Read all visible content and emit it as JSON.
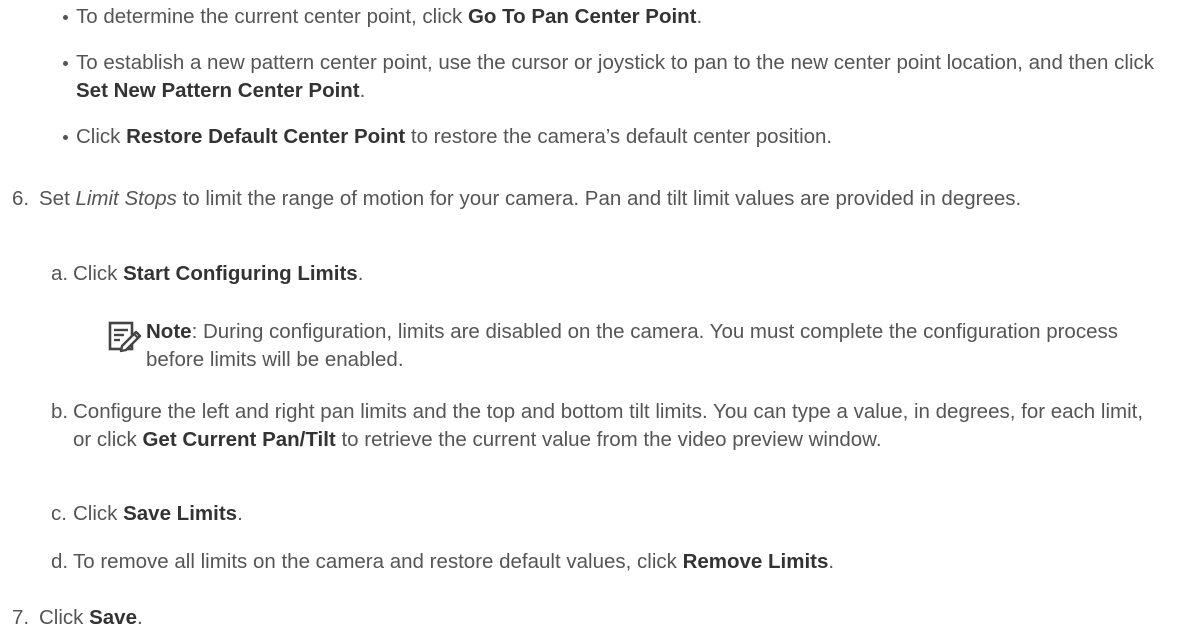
{
  "bullets": [
    {
      "pre": "To determine the current center point, click ",
      "bold": "Go To Pan Center Point",
      "post": "."
    },
    {
      "pre": "To establish a new pattern center point, use the cursor or joystick to pan to the new center point location, and then click ",
      "bold": "Set New Pattern Center Point",
      "post": "."
    },
    {
      "pre": "Click ",
      "bold": "Restore Default Center Point",
      "post": " to restore the camera’s default center position."
    }
  ],
  "step6": {
    "number": "6.",
    "pre": "Set ",
    "italic": "Limit Stops",
    "post": " to limit the range of motion for your camera. Pan and tilt limit values are provided in degrees."
  },
  "sub_a": {
    "number": "a.",
    "pre": "Click ",
    "bold": "Start Configuring Limits",
    "post": "."
  },
  "note": {
    "label": "Note",
    "text": ": During configuration, limits are disabled on the camera. You must complete the configuration process before limits will be enabled."
  },
  "sub_b": {
    "number": "b.",
    "pre": "Configure the left and right pan limits and the top and bottom tilt limits. You can type a value, in degrees, for each limit, or click ",
    "bold": "Get Current Pan/Tilt",
    "post": " to retrieve the current value from the video preview window."
  },
  "sub_c": {
    "number": "c.",
    "pre": "Click ",
    "bold": "Save Limits",
    "post": "."
  },
  "sub_d": {
    "number": "d.",
    "pre": "To remove all limits on the camera and restore default values, click ",
    "bold": "Remove Limits",
    "post": "."
  },
  "step7": {
    "number": "7.",
    "pre": "Click ",
    "bold": "Save",
    "post": "."
  },
  "icons": {
    "note": "note-pencil-icon"
  }
}
